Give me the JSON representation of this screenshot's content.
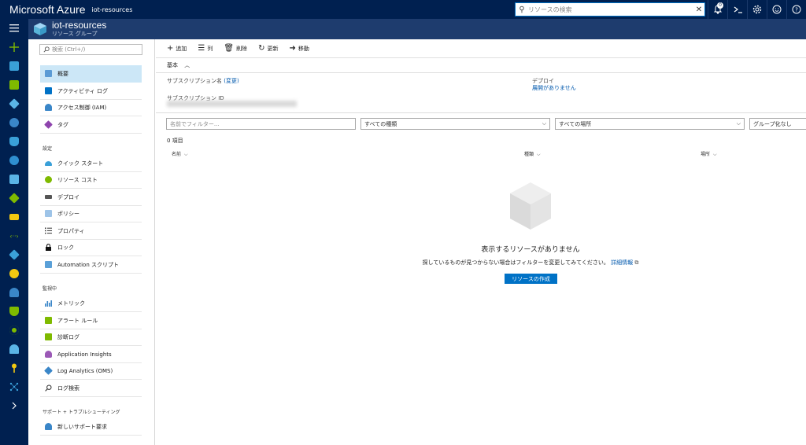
{
  "topbar": {
    "brand": "Microsoft Azure",
    "breadcrumb": "iot-resources",
    "search_placeholder": "リソースの検索",
    "notification_count": "0",
    "icons": [
      "bell-icon",
      "cloud-shell-icon",
      "gear-icon",
      "smiley-icon",
      "help-icon"
    ]
  },
  "blade": {
    "title": "iot-resources",
    "subtitle": "リソース グループ"
  },
  "menu": {
    "search_placeholder": "検索 (Ctrl+/)",
    "items": [
      {
        "label": "概要",
        "active": true,
        "color": "#5b9bd5"
      },
      {
        "label": "アクティビティ ログ",
        "color": "#0072c6"
      },
      {
        "label": "アクセス制御 (IAM)",
        "color": "#3a86c8"
      },
      {
        "label": "タグ",
        "color": "#8e44ad"
      }
    ],
    "section_settings": "設定",
    "settings": [
      {
        "label": "クイック スタート",
        "color": "#3aa0d8"
      },
      {
        "label": "リソース コスト",
        "color": "#7fba00"
      },
      {
        "label": "デプロイ",
        "color": "#555555"
      },
      {
        "label": "ポリシー",
        "color": "#9ec4e8"
      },
      {
        "label": "プロパティ",
        "color": "#333333"
      },
      {
        "label": "ロック",
        "color": "#111111"
      },
      {
        "label": "Automation スクリプト",
        "color": "#5aa0d8"
      }
    ],
    "section_monitoring": "監視中",
    "monitoring": [
      {
        "label": "メトリック",
        "color": "#3a86c8"
      },
      {
        "label": "アラート ルール",
        "color": "#7fba00"
      },
      {
        "label": "診断ログ",
        "color": "#7fba00"
      },
      {
        "label": "Application Insights",
        "color": "#9b59b6"
      },
      {
        "label": "Log Analytics (OMS)",
        "color": "#3a86c8"
      },
      {
        "label": "ログ検索",
        "color": "#333333"
      }
    ],
    "section_support": "サポート + トラブルシューティング",
    "support": [
      {
        "label": "新しいサポート要求",
        "color": "#3a86c8"
      }
    ]
  },
  "toolbar": {
    "add": "追加",
    "columns": "列",
    "delete": "削除",
    "refresh": "更新",
    "move": "移動"
  },
  "essentials": {
    "header": "基本",
    "subscription_label": "サブスクリプション名",
    "subscription_change": "(変更)",
    "subscription_id_label": "サブスクリプション ID",
    "deploy_label": "デプロイ",
    "deploy_value": "展開がありません"
  },
  "filters": {
    "name_placeholder": "名前でフィルター...",
    "type": "すべての種類",
    "location": "すべての場所",
    "grouping": "グループ化なし"
  },
  "list": {
    "count": "0 項目",
    "columns": [
      "名前",
      "種類",
      "場所"
    ]
  },
  "empty": {
    "title": "表示するリソースがありません",
    "description": "探しているものが見つからない場合はフィルターを変更してみてください。",
    "link": "詳細情報",
    "create_button": "リソースの作成"
  },
  "colors": {
    "topbar": "#002050",
    "blade_header": "#1e3c6e",
    "accent": "#0072c6",
    "active_item": "#cce7f7"
  }
}
